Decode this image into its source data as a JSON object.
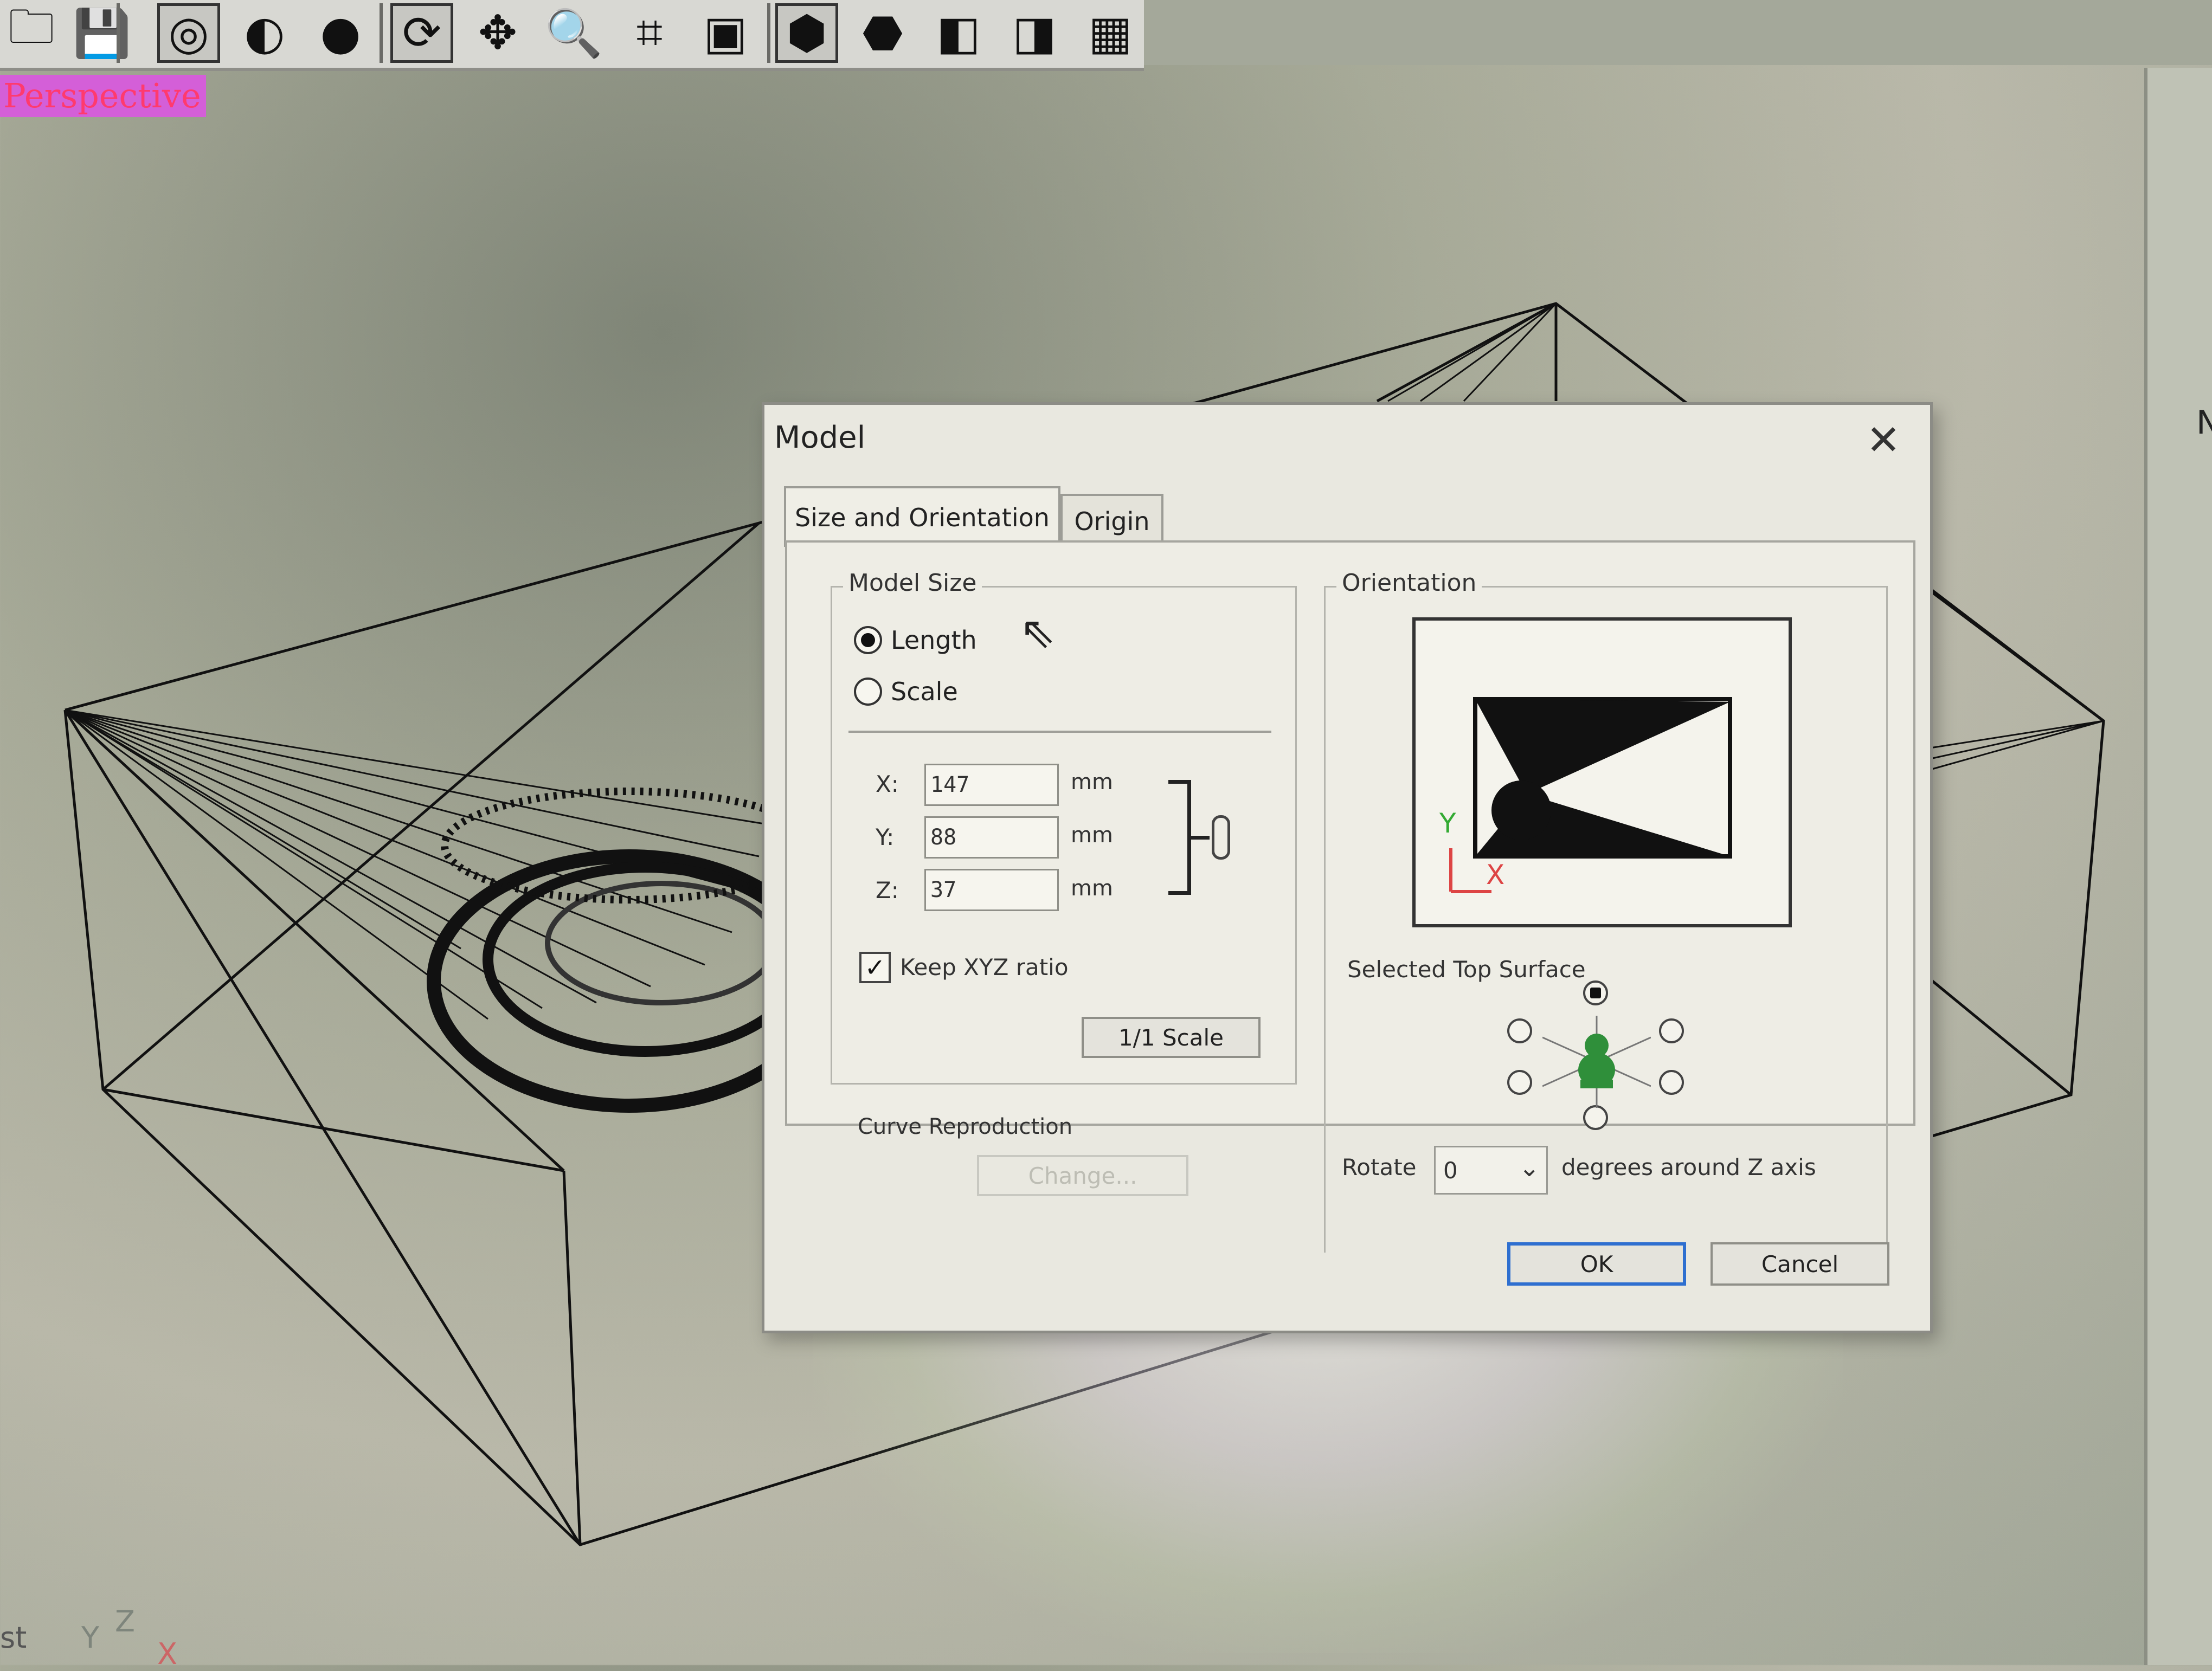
{
  "toolbar": {
    "buttons": [
      {
        "name": "open-folder-icon",
        "glyph": "🗀"
      },
      {
        "name": "save-icon",
        "glyph": "💾"
      },
      {
        "name": "wireframe-sphere-icon",
        "glyph": "◎"
      },
      {
        "name": "half-shaded-sphere-icon",
        "glyph": "◐"
      },
      {
        "name": "shaded-sphere-icon",
        "glyph": "●"
      },
      {
        "name": "rotate-view-icon",
        "glyph": "⟳"
      },
      {
        "name": "pan-view-icon",
        "glyph": "✥"
      },
      {
        "name": "zoom-icon",
        "glyph": "🔍"
      },
      {
        "name": "fit-view-icon",
        "glyph": "⌗"
      },
      {
        "name": "zoom-selection-icon",
        "glyph": "▣"
      },
      {
        "name": "cube-view-iso-icon",
        "glyph": "⬢"
      },
      {
        "name": "cube-view-front-icon",
        "glyph": "⬣"
      },
      {
        "name": "cube-view-side-icon",
        "glyph": "◧"
      },
      {
        "name": "cube-view-top-icon",
        "glyph": "◨"
      },
      {
        "name": "four-views-icon",
        "glyph": "▦"
      }
    ]
  },
  "viewport": {
    "label": "Perspective",
    "axis_y": "Y",
    "axis_z": "Z",
    "axis_x": "X",
    "status_fragment": "st",
    "right_panel_fragment": "N"
  },
  "dialog": {
    "title": "Model",
    "close_glyph": "✕",
    "tabs": [
      {
        "label": "Size and Orientation",
        "active": true
      },
      {
        "label": "Origin",
        "active": false
      }
    ],
    "model_size": {
      "legend": "Model Size",
      "options": [
        {
          "label": "Length",
          "selected": true
        },
        {
          "label": "Scale",
          "selected": false
        }
      ],
      "fields": [
        {
          "label": "X:",
          "value": "147",
          "unit": "mm"
        },
        {
          "label": "Y:",
          "value": "88",
          "unit": "mm"
        },
        {
          "label": "Z:",
          "value": "37",
          "unit": "mm"
        }
      ],
      "keep_ratio": {
        "label": "Keep XYZ ratio",
        "checked": true,
        "glyph": "✓"
      },
      "one_to_one_button": "1/1 Scale"
    },
    "curve_reproduction": {
      "label": "Curve Reproduction",
      "change_button": "Change..."
    },
    "orientation": {
      "legend": "Orientation",
      "preview_axis_y": "Y",
      "preview_axis_x": "X",
      "selected_top_surface_label": "Selected Top Surface",
      "rotate_label": "Rotate",
      "rotate_value": "0",
      "rotate_arrow": "⌄",
      "rotate_suffix": "degrees around Z axis"
    },
    "ok_button": "OK",
    "cancel_button": "Cancel"
  },
  "colors": {
    "viewport_label_bg": "#d45fd8",
    "viewport_label_text": "#ff3a6e",
    "ok_focus_border": "#2e6fd0",
    "mesh_figure": "#2f8f3a"
  }
}
